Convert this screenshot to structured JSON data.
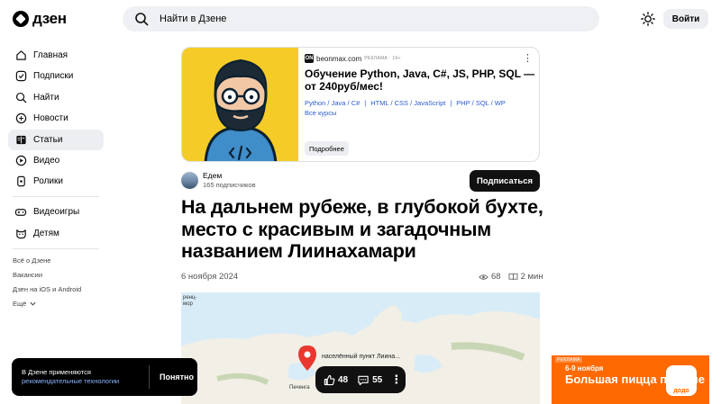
{
  "header": {
    "logo_text": "дзен",
    "search_placeholder": "Найти в Дзене",
    "login_label": "Войти"
  },
  "sidebar": {
    "items": [
      {
        "label": "Главная",
        "icon": "home-icon"
      },
      {
        "label": "Подписки",
        "icon": "subscriptions-icon"
      },
      {
        "label": "Найти",
        "icon": "search-icon"
      },
      {
        "label": "Новости",
        "icon": "news-icon"
      },
      {
        "label": "Статьи",
        "icon": "articles-icon",
        "active": true
      },
      {
        "label": "Видео",
        "icon": "video-icon"
      },
      {
        "label": "Ролики",
        "icon": "shorts-icon"
      }
    ],
    "items2": [
      {
        "label": "Видеоигры",
        "icon": "gamepad-icon"
      },
      {
        "label": "Детям",
        "icon": "kids-icon"
      }
    ],
    "footer_links": [
      "Всё о Дзене",
      "Вакансии",
      "Дзен на iOS и Android",
      "Ещё"
    ]
  },
  "ad": {
    "source": "beonmax.com",
    "tag": "РЕКЛАМА · 16+",
    "headline": "Обучение Python, Java, C#, JS, PHP, SQL — от 240руб/мес!",
    "links": [
      "Python / Java / C#",
      "HTML / CSS / JavaScript",
      "PHP / SQL / WP"
    ],
    "all_courses": "Все курсы",
    "more_label": "Подробнее"
  },
  "author": {
    "name": "Едем",
    "subscribers": "165 подписчиков",
    "subscribe_label": "Подписаться"
  },
  "article": {
    "title": "На дальнем рубеже, в глубокой бухте, место с красивым и загадочным названием Лиинахамари",
    "date": "6 ноября 2024",
    "views": "68",
    "read_time": "2 мин"
  },
  "map": {
    "pin_label": "населённый пункт Лиина...",
    "labels": [
      "Печенга",
      "ренц-",
      "мор"
    ]
  },
  "actions": {
    "likes": "48",
    "comments": "55"
  },
  "cookie": {
    "text": "В Дзене применяются",
    "link": "рекомендательные технологии",
    "ok_label": "Понятно"
  },
  "banner": {
    "tag": "РЕКЛАМА",
    "dates": "6-9 ноября",
    "headline": "Большая пицца по цене",
    "brand": "додо"
  },
  "colors": {
    "accent_link": "#2b5ccf",
    "ad_yellow": "#f5cb28",
    "banner_orange": "#ff6900"
  }
}
